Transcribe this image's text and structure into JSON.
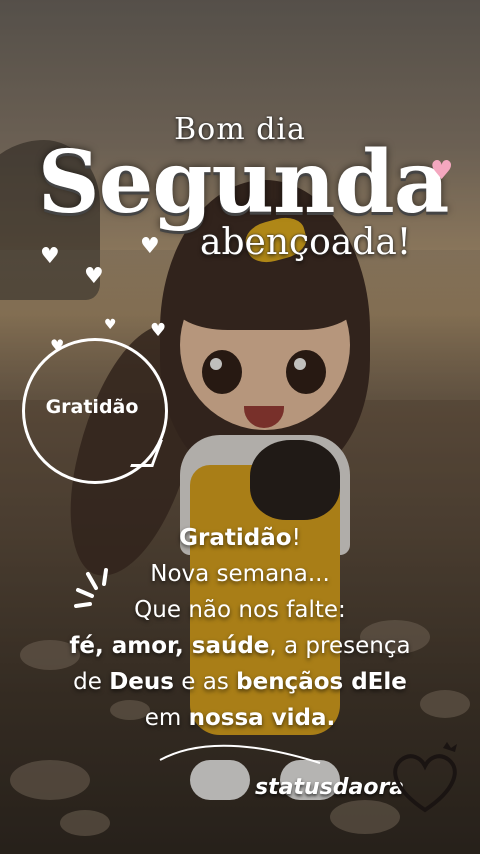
{
  "title": {
    "top": "Bom dia",
    "main": "Segunda",
    "sub": "abençoada!"
  },
  "badge": {
    "label": "Gratidão"
  },
  "message": {
    "line1_bold": "Gratidão",
    "line1_rest": "!",
    "line2": "Nova semana...",
    "line3": "Que não nos falte:",
    "line4_bold": "fé, amor, saúde",
    "line4_rest": ", a presença",
    "line5_a": "de ",
    "line5_bold1": "Deus",
    "line5_b": " e as ",
    "line5_bold2": "bençãos dEle",
    "line6_a": "em ",
    "line6_bold": "nossa vida."
  },
  "brand": {
    "name": "statusdaora"
  },
  "colors": {
    "text": "#ffffff",
    "heart_pink": "#f4a7bf",
    "overalls": "#e0a61a"
  },
  "icons": [
    "heart-icon",
    "sparkle-rays-icon",
    "heart-logo-icon"
  ]
}
